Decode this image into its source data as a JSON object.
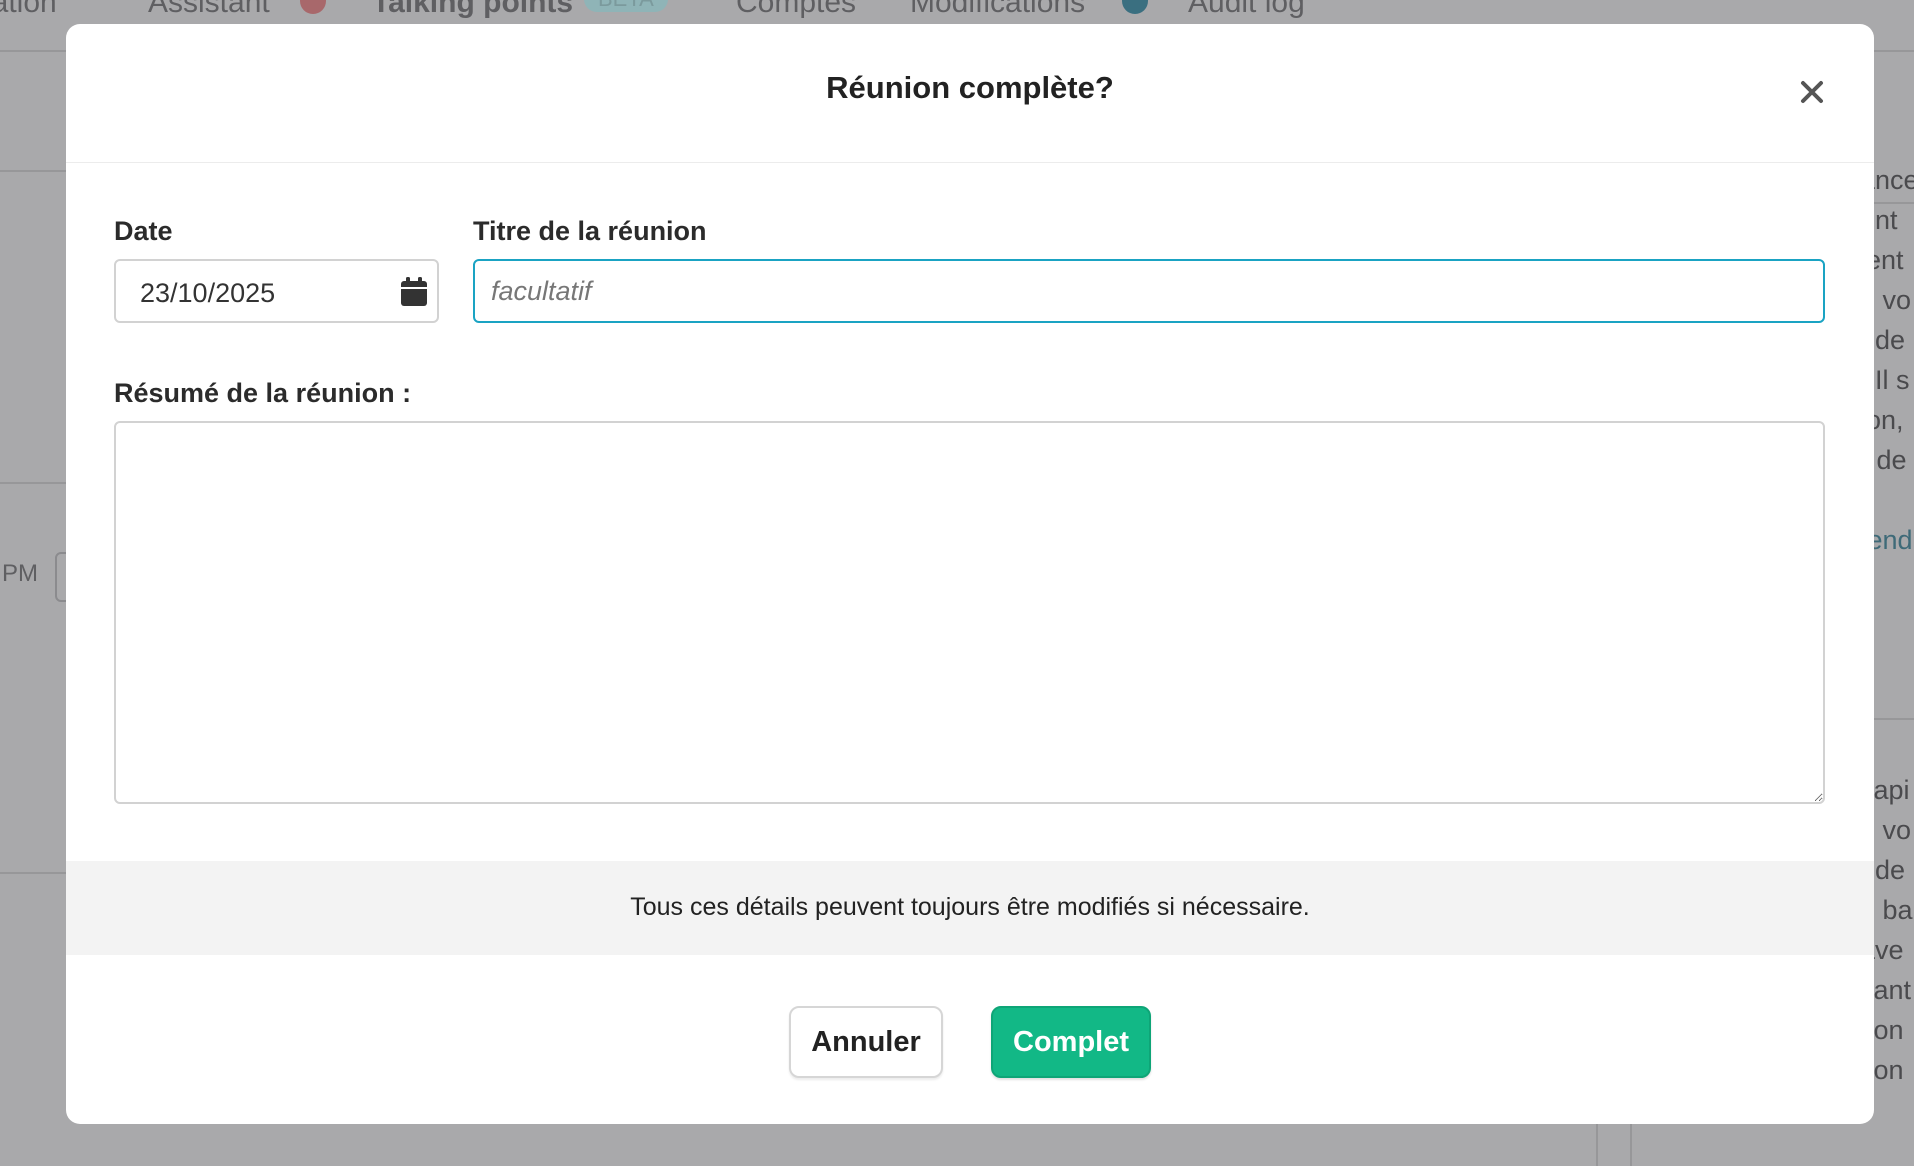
{
  "background": {
    "nav_items": [
      "ication",
      "Assistant",
      "Talking points",
      "Comptes",
      "Modifications",
      "Audit log"
    ],
    "nav_badge": "BETA",
    "left_fragment": "PM",
    "right_fragments_top": [
      "ance",
      "ent",
      "ient",
      "e vo",
      "t de",
      ". Il s",
      "lon,",
      "r de"
    ],
    "right_link_fragment": "tend",
    "right_fragments_bottom": [
      "capi",
      "e vo",
      "t de",
      "e ba",
      " ave",
      "vant",
      "tion",
      " con"
    ]
  },
  "modal": {
    "title": "Réunion complète?",
    "close_icon": "close-icon",
    "date": {
      "label": "Date",
      "value": "23/10/2025",
      "icon": "calendar-icon"
    },
    "meeting_title": {
      "label": "Titre de la réunion",
      "placeholder": "facultatif",
      "value": ""
    },
    "summary": {
      "label": "Résumé de la réunion :",
      "value": ""
    },
    "info_text": "Tous ces détails peuvent toujours être modifiés si nécessaire.",
    "buttons": {
      "cancel_label": "Annuler",
      "complete_label": "Complet"
    }
  },
  "colors": {
    "accent": "#1aa3c3",
    "complete_button": "#12b886",
    "overlay": "#a9a9ab"
  }
}
